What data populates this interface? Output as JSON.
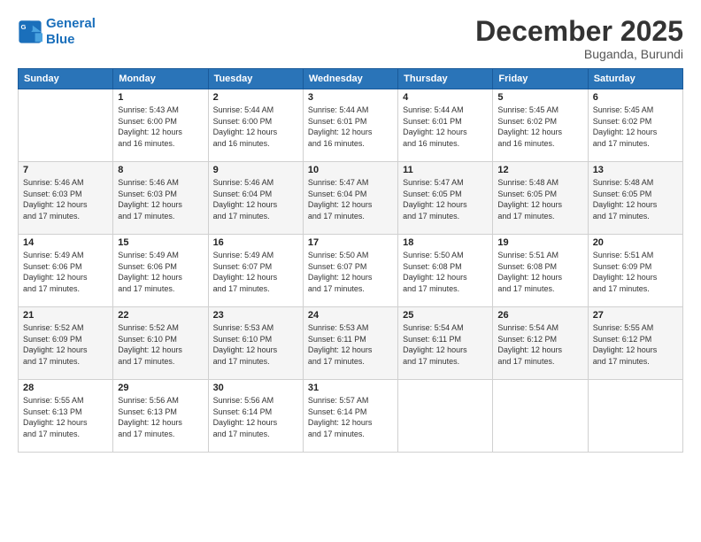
{
  "header": {
    "logo_line1": "General",
    "logo_line2": "Blue",
    "month_title": "December 2025",
    "subtitle": "Buganda, Burundi"
  },
  "weekdays": [
    "Sunday",
    "Monday",
    "Tuesday",
    "Wednesday",
    "Thursday",
    "Friday",
    "Saturday"
  ],
  "weeks": [
    [
      {
        "day": "",
        "info": ""
      },
      {
        "day": "1",
        "info": "Sunrise: 5:43 AM\nSunset: 6:00 PM\nDaylight: 12 hours\nand 16 minutes."
      },
      {
        "day": "2",
        "info": "Sunrise: 5:44 AM\nSunset: 6:00 PM\nDaylight: 12 hours\nand 16 minutes."
      },
      {
        "day": "3",
        "info": "Sunrise: 5:44 AM\nSunset: 6:01 PM\nDaylight: 12 hours\nand 16 minutes."
      },
      {
        "day": "4",
        "info": "Sunrise: 5:44 AM\nSunset: 6:01 PM\nDaylight: 12 hours\nand 16 minutes."
      },
      {
        "day": "5",
        "info": "Sunrise: 5:45 AM\nSunset: 6:02 PM\nDaylight: 12 hours\nand 16 minutes."
      },
      {
        "day": "6",
        "info": "Sunrise: 5:45 AM\nSunset: 6:02 PM\nDaylight: 12 hours\nand 17 minutes."
      }
    ],
    [
      {
        "day": "7",
        "info": "Sunrise: 5:46 AM\nSunset: 6:03 PM\nDaylight: 12 hours\nand 17 minutes."
      },
      {
        "day": "8",
        "info": "Sunrise: 5:46 AM\nSunset: 6:03 PM\nDaylight: 12 hours\nand 17 minutes."
      },
      {
        "day": "9",
        "info": "Sunrise: 5:46 AM\nSunset: 6:04 PM\nDaylight: 12 hours\nand 17 minutes."
      },
      {
        "day": "10",
        "info": "Sunrise: 5:47 AM\nSunset: 6:04 PM\nDaylight: 12 hours\nand 17 minutes."
      },
      {
        "day": "11",
        "info": "Sunrise: 5:47 AM\nSunset: 6:05 PM\nDaylight: 12 hours\nand 17 minutes."
      },
      {
        "day": "12",
        "info": "Sunrise: 5:48 AM\nSunset: 6:05 PM\nDaylight: 12 hours\nand 17 minutes."
      },
      {
        "day": "13",
        "info": "Sunrise: 5:48 AM\nSunset: 6:05 PM\nDaylight: 12 hours\nand 17 minutes."
      }
    ],
    [
      {
        "day": "14",
        "info": "Sunrise: 5:49 AM\nSunset: 6:06 PM\nDaylight: 12 hours\nand 17 minutes."
      },
      {
        "day": "15",
        "info": "Sunrise: 5:49 AM\nSunset: 6:06 PM\nDaylight: 12 hours\nand 17 minutes."
      },
      {
        "day": "16",
        "info": "Sunrise: 5:49 AM\nSunset: 6:07 PM\nDaylight: 12 hours\nand 17 minutes."
      },
      {
        "day": "17",
        "info": "Sunrise: 5:50 AM\nSunset: 6:07 PM\nDaylight: 12 hours\nand 17 minutes."
      },
      {
        "day": "18",
        "info": "Sunrise: 5:50 AM\nSunset: 6:08 PM\nDaylight: 12 hours\nand 17 minutes."
      },
      {
        "day": "19",
        "info": "Sunrise: 5:51 AM\nSunset: 6:08 PM\nDaylight: 12 hours\nand 17 minutes."
      },
      {
        "day": "20",
        "info": "Sunrise: 5:51 AM\nSunset: 6:09 PM\nDaylight: 12 hours\nand 17 minutes."
      }
    ],
    [
      {
        "day": "21",
        "info": "Sunrise: 5:52 AM\nSunset: 6:09 PM\nDaylight: 12 hours\nand 17 minutes."
      },
      {
        "day": "22",
        "info": "Sunrise: 5:52 AM\nSunset: 6:10 PM\nDaylight: 12 hours\nand 17 minutes."
      },
      {
        "day": "23",
        "info": "Sunrise: 5:53 AM\nSunset: 6:10 PM\nDaylight: 12 hours\nand 17 minutes."
      },
      {
        "day": "24",
        "info": "Sunrise: 5:53 AM\nSunset: 6:11 PM\nDaylight: 12 hours\nand 17 minutes."
      },
      {
        "day": "25",
        "info": "Sunrise: 5:54 AM\nSunset: 6:11 PM\nDaylight: 12 hours\nand 17 minutes."
      },
      {
        "day": "26",
        "info": "Sunrise: 5:54 AM\nSunset: 6:12 PM\nDaylight: 12 hours\nand 17 minutes."
      },
      {
        "day": "27",
        "info": "Sunrise: 5:55 AM\nSunset: 6:12 PM\nDaylight: 12 hours\nand 17 minutes."
      }
    ],
    [
      {
        "day": "28",
        "info": "Sunrise: 5:55 AM\nSunset: 6:13 PM\nDaylight: 12 hours\nand 17 minutes."
      },
      {
        "day": "29",
        "info": "Sunrise: 5:56 AM\nSunset: 6:13 PM\nDaylight: 12 hours\nand 17 minutes."
      },
      {
        "day": "30",
        "info": "Sunrise: 5:56 AM\nSunset: 6:14 PM\nDaylight: 12 hours\nand 17 minutes."
      },
      {
        "day": "31",
        "info": "Sunrise: 5:57 AM\nSunset: 6:14 PM\nDaylight: 12 hours\nand 17 minutes."
      },
      {
        "day": "",
        "info": ""
      },
      {
        "day": "",
        "info": ""
      },
      {
        "day": "",
        "info": ""
      }
    ]
  ]
}
